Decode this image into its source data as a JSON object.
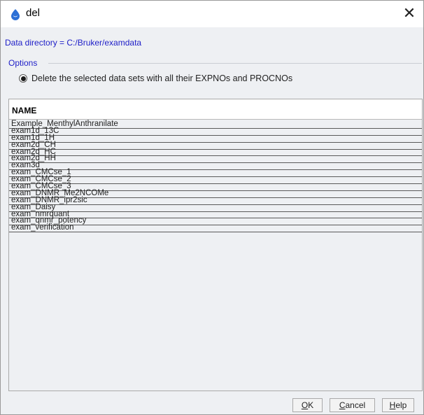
{
  "window": {
    "title": "del",
    "close_glyph": "✕"
  },
  "data_directory": "Data directory = C:/Bruker/examdata",
  "options": {
    "legend": "Options",
    "radio_label": "Delete the selected data sets with all their EXPNOs and PROCNOs",
    "radio_selected": true
  },
  "table": {
    "header": "NAME",
    "rows": [
      "Example_MenthylAnthranilate",
      "exam1d_13C",
      "exam1d_1H",
      "exam2d_CH",
      "exam2d_HC",
      "exam2d_HH",
      "exam3d",
      "exam_CMCse_1",
      "exam_CMCse_2",
      "exam_CMCse_3",
      "exam_DNMR_Me2NCOMe",
      "exam_DNMR_ipr2sic",
      "exam_Daisy",
      "exam_nmrquant",
      "exam_qnmr_potency",
      "exam_verification"
    ]
  },
  "buttons": {
    "ok": {
      "mnemonic": "O",
      "rest": "K"
    },
    "cancel": {
      "mnemonic": "C",
      "rest": "ancel"
    },
    "help": {
      "mnemonic": "H",
      "rest": "elp"
    }
  },
  "icons": {
    "app": "topspin-drop-icon",
    "close": "close-icon"
  },
  "colors": {
    "link_text": "#2020c8",
    "panel_bg": "#eef0f3"
  }
}
